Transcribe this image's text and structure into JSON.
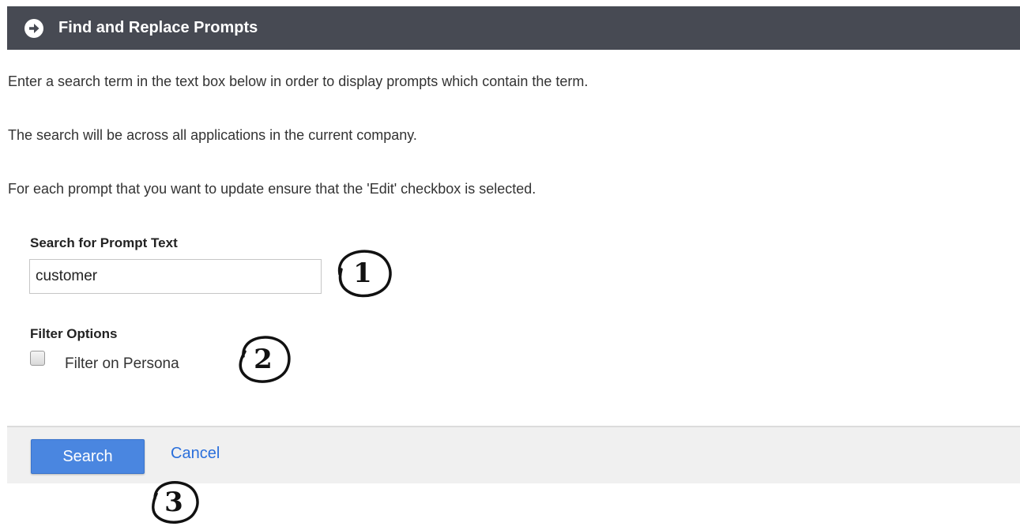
{
  "header": {
    "title": "Find and Replace Prompts",
    "icon": "arrow-right-circle-icon"
  },
  "intro": {
    "line1": "Enter a search term in the text box below in order to display prompts which contain the term.",
    "line2": "The search will be across all applications in the current company.",
    "line3": "For each prompt that you want to update ensure that the 'Edit' checkbox is selected."
  },
  "search": {
    "label": "Search for Prompt Text",
    "value": "customer"
  },
  "filter": {
    "label": "Filter Options",
    "persona_label": "Filter on Persona",
    "persona_checked": false
  },
  "footer": {
    "search_label": "Search",
    "cancel_label": "Cancel"
  },
  "callouts": [
    "1",
    "2",
    "3"
  ],
  "colors": {
    "header_bg": "#474a53",
    "button_bg": "#4a86e0",
    "link": "#2a6fdb",
    "footer_bg": "#f0f0f0"
  }
}
